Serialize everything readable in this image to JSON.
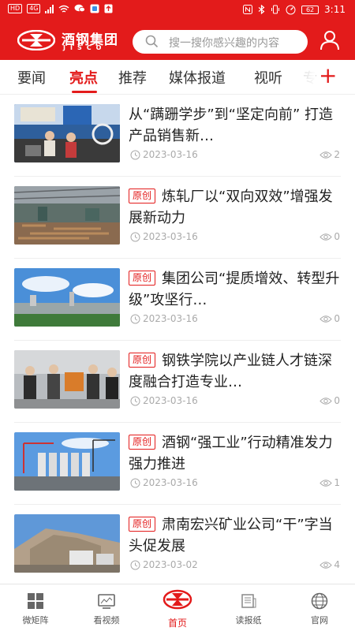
{
  "status_bar": {
    "left_badges": [
      "HD",
      "4G"
    ],
    "time": "3:11",
    "battery": "62"
  },
  "header": {
    "brand_cn": "酒钢集团",
    "brand_en": "JISCO",
    "search_placeholder": "搜一搜你感兴趣的内容",
    "accent_color": "#e31b1b"
  },
  "tabs": {
    "items": [
      "要闻",
      "亮点",
      "推荐",
      "媒体报道",
      "视听",
      "专"
    ],
    "active": "亮点",
    "add_label": "+"
  },
  "news": [
    {
      "title": "从“蹒跚学步”到“坚定向前” 打造产品销售新…",
      "tag": "",
      "date": "2023-03-16",
      "views": "2"
    },
    {
      "title": "炼轧厂以“双向双效”增强发展新动力",
      "tag": "原创",
      "date": "2023-03-16",
      "views": "0"
    },
    {
      "title": "集团公司“提质增效、转型升级”攻坚行…",
      "tag": "原创",
      "date": "2023-03-16",
      "views": "0"
    },
    {
      "title": "钢铁学院以产业链人才链深度融合打造专业…",
      "tag": "原创",
      "date": "2023-03-16",
      "views": "0"
    },
    {
      "title": "酒钢“强工业”行动精准发力强力推进",
      "tag": "原创",
      "date": "2023-03-16",
      "views": "1"
    },
    {
      "title": "肃南宏兴矿业公司“干”字当头促发展",
      "tag": "原创",
      "date": "2023-03-02",
      "views": "4"
    }
  ],
  "bottom_nav": {
    "items": [
      "微矩阵",
      "看视频",
      "首页",
      "读报纸",
      "官网"
    ],
    "active": "首页"
  }
}
